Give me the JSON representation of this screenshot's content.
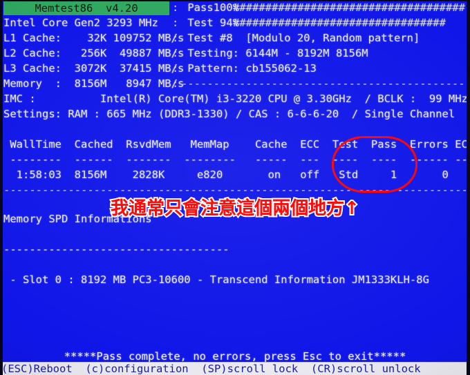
{
  "app": {
    "title": "Memtest86  v4.20",
    "title_bg": "#2fa85f",
    "screen_bg": "#1016e8"
  },
  "left_panel": {
    "lines": [
      "Intel Core Gen2 3293 MHz",
      "L1 Cache:    32K 109752 MB/s",
      "L2 Cache:   256K  49887 MB/s",
      "L3 Cache:  3072K  37415 MB/s",
      "Memory  :  8156M   8947 MB/s"
    ],
    "cpu_model": "Intel Core Gen2",
    "cpu_speed": "3293 MHz",
    "l1_size": "32K",
    "l1_speed": "109752 MB/s",
    "l2_size": "256K",
    "l2_speed": "49887 MB/s",
    "l3_size": "3072K",
    "l3_speed": "37415 MB/s",
    "memory_size": "8156M",
    "memory_speed": "8947 MB/s"
  },
  "right_panel": {
    "lines": [
      " Pass100%",
      " Test 94%",
      " Test #8  [Modulo 20, Random pattern]",
      " Testing: 6144M - 8192M 8156M",
      " Pattern: cb155062-13"
    ],
    "pass_label": "Pass100%",
    "test_label": "Test 94%",
    "test_number": "Test #8",
    "test_name": "[Modulo 20, Random pattern]",
    "testing_range": "Testing: 6144M - 8192M 8156M",
    "pattern": "Pattern: cb155062-13",
    "pass_percent": 100,
    "test_percent": 94,
    "pass_bar": "###############################################",
    "test_bar": "###############################################"
  },
  "separators": {
    "vertical": ":\n:\n:\n:\n:\n:",
    "top_rule": "-----------------------------------------------------------",
    "header_rule": "---------------------------------------------------------------------------------------------"
  },
  "system": {
    "imc_label": "IMC :",
    "imc_value": "Intel(R) Core(TM) i3-3220 CPU @ 3.30GHz  / BCLK :  99 MHz",
    "imc_line": "IMC :          Intel(R) Core(TM) i3-3220 CPU @ 3.30GHz  / BCLK :  99 MHz",
    "settings_label": "Settings:",
    "settings_value": "RAM : 665 MHz (DDR3-1330) / CAS : 6-6-6-20  / Single Channel",
    "settings_line": "Settings: RAM : 665 MHz (DDR3-1330) / CAS : 6-6-6-20  / Single Channel"
  },
  "table": {
    "header_line": " WallTime  Cached  RsvdMem   MemMap    Cache  ECC  Test  Pass  Errors ECC Errs",
    "rule_line": " --------  ------  -------  --------   -----  ---  ----  ----  ------ --------",
    "values_line": "  1:58:03  8156M    2828K     e820       on   off   Std     1       0",
    "headers": [
      "WallTime",
      "Cached",
      "RsvdMem",
      "MemMap",
      "Cache",
      "ECC",
      "Test",
      "Pass",
      "Errors",
      "ECC Errs"
    ],
    "values": [
      "1:58:03",
      "8156M",
      "2828K",
      "e820",
      "on",
      "off",
      "Std",
      "1",
      "0",
      ""
    ]
  },
  "spd": {
    "heading": "Memory SPD Informations",
    "rule": "-----------------------------------",
    "slot_line": " - Slot 0 : 8192 MB PC3-10600 - Transcend Information JM1333KLH-8G",
    "slot": "Slot 0",
    "size": "8192 MB",
    "type": "PC3-10600",
    "vendor": "Transcend Information",
    "part": "JM1333KLH-8G"
  },
  "status": {
    "pass_message": "*****Pass complete, no errors, press Esc to exit*****",
    "keys_line": "(ESC)Reboot  (c)configuration  (SP)scroll lock  (CR)scroll unlock",
    "keys": [
      "(ESC)Reboot",
      "(c)configuration",
      "(SP)scroll lock",
      "(CR)scroll unlock"
    ]
  },
  "annotation": {
    "text": "我通常只會注意這個兩個地方↑",
    "color": "#ff0000",
    "outline_color": "#ffffff",
    "highlight_shape": "ellipse",
    "highlight_target": "Pass / Errors columns"
  }
}
